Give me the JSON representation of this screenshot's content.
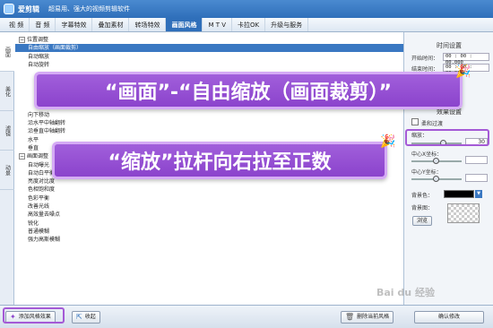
{
  "titlebar": {
    "app_name": "爱剪辑",
    "slogan": "超易用、强大的视频剪辑软件"
  },
  "menu": [
    "视 频",
    "音 频",
    "字幕特效",
    "叠加素材",
    "转场特效",
    "画面风格",
    "M T V",
    "卡拉OK",
    "升级与服务"
  ],
  "menu_active": "画面风格",
  "left_tabs": [
    "画面",
    "美化",
    "滤镜",
    "动景"
  ],
  "tree": [
    {
      "text": "位置调整",
      "indent": 0,
      "node": "−"
    },
    {
      "text": "自由缩放（画面裁剪）",
      "indent": 1,
      "selected": true
    },
    {
      "text": "自动缩放",
      "indent": 1
    },
    {
      "text": "自动旋转",
      "indent": 1
    },
    {
      "text": "",
      "indent": 1
    },
    {
      "text": "",
      "indent": 1
    },
    {
      "text": "",
      "indent": 1
    },
    {
      "text": "",
      "indent": 1
    },
    {
      "text": "",
      "indent": 1
    },
    {
      "text": "向下移动",
      "indent": 1
    },
    {
      "text": "沿水平中轴翻转",
      "indent": 1
    },
    {
      "text": "沿垂直中轴翻转",
      "indent": 1
    },
    {
      "text": "水平",
      "indent": 1
    },
    {
      "text": "垂直",
      "indent": 1
    },
    {
      "text": "画面调整",
      "indent": 0,
      "node": "−"
    },
    {
      "text": "自动曝光",
      "indent": 1
    },
    {
      "text": "自动白平衡",
      "indent": 1
    },
    {
      "text": "亮度对比度",
      "indent": 1
    },
    {
      "text": "色相饱和度",
      "indent": 1
    },
    {
      "text": "色彩平衡",
      "indent": 1
    },
    {
      "text": "改善光线",
      "indent": 1
    },
    {
      "text": "高效量去噪点",
      "indent": 1
    },
    {
      "text": "锐化",
      "indent": 1
    },
    {
      "text": "普通模糊",
      "indent": 1
    },
    {
      "text": "强力高斯模糊",
      "indent": 1
    }
  ],
  "right_panel": {
    "time_title": "时间设置",
    "start_label": "开始时间：",
    "start_value": "00 : 00 : 00.000",
    "end_label": "结束时间：",
    "end_value": "00 : 00 : 00.000",
    "param_title": "效果设置",
    "smooth_label": "柔和过渡",
    "scale_label": "缩放：",
    "scale_value": "30",
    "center_x_label": "中心X坐标：",
    "center_y_label": "中心Y坐标：",
    "bg_color_label": "背景色：",
    "bg_image_label": "背景图：",
    "browse_label": "浏览"
  },
  "bottom": {
    "add_style": "添加风格效果",
    "collapse": "收起",
    "delete_style": "删除当前风格",
    "confirm": "确认修改"
  },
  "overlay": {
    "banner1": "“画面”-“自由缩放（画面裁剪）”",
    "banner2": "“缩放”拉杆向右拉至正数"
  },
  "watermark": "Bai du 经验",
  "colors": {
    "accent": "#2f6fba",
    "highlight": "#a45ad6",
    "banner": "#9a52d6"
  }
}
